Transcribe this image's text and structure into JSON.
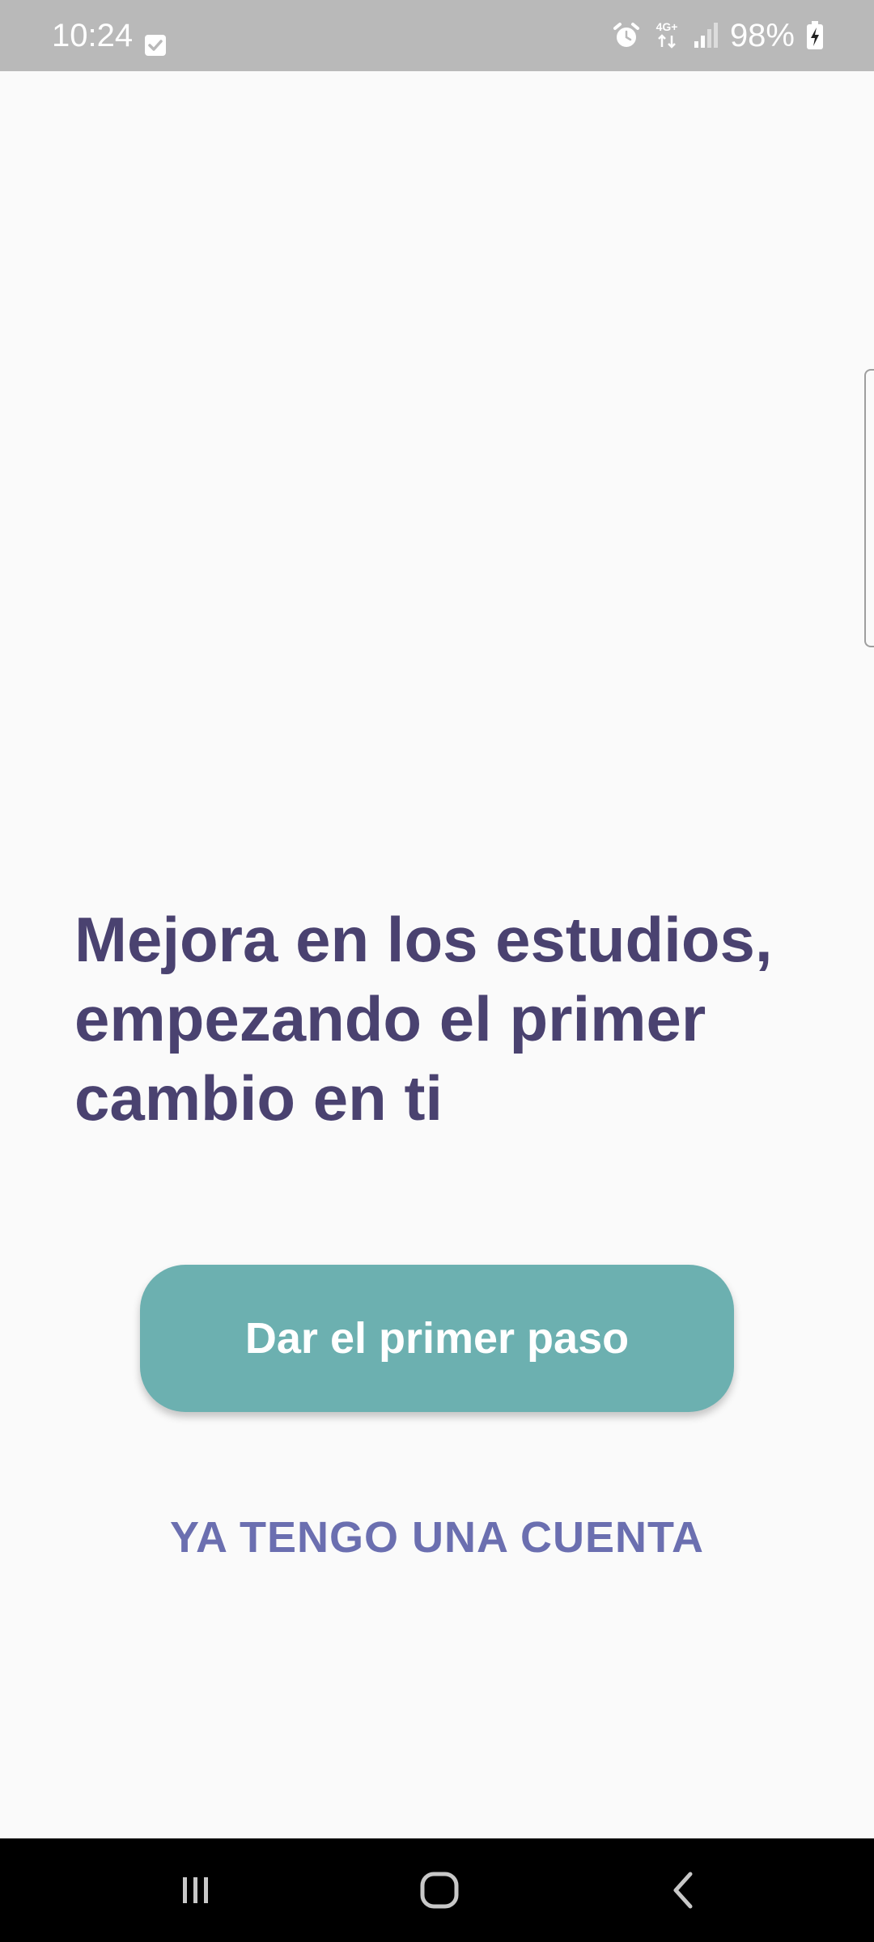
{
  "status_bar": {
    "time": "10:24",
    "battery": "98%",
    "network": "4G+",
    "icons": [
      "checkbox-notification-icon",
      "alarm-icon",
      "network-4g-icon",
      "signal-icon",
      "battery-charging-icon"
    ]
  },
  "main": {
    "headline": "Mejora en los estudios, empezando el primer cambio en ti",
    "primary_button_label": "Dar el primer paso",
    "secondary_button_label": "YA TENGO UNA CUENTA"
  },
  "nav_bar": {
    "icons": [
      "recents-icon",
      "home-icon",
      "back-icon"
    ]
  },
  "colors": {
    "headline": "#4a4270",
    "primary_button": "#6cb0b0",
    "secondary_text": "#6b6fb0",
    "status_bar": "#b9b9b9",
    "background": "#fafafa"
  }
}
